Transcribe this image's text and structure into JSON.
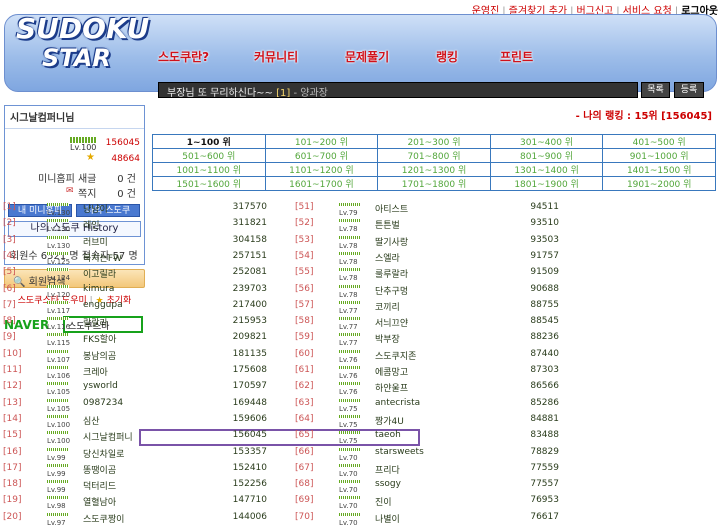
{
  "top_links": [
    "운영진",
    "즐겨찾기 추가",
    "버그신고",
    "서비스 요청",
    "로그아웃"
  ],
  "logo": {
    "line1": "SUDOKU",
    "line2": "STAR"
  },
  "menu": [
    "스도쿠란?",
    "커뮤니티",
    "문제풀기",
    "랭킹",
    "프린트"
  ],
  "notice": {
    "text": "부장님 또 무리하신다~~",
    "num": "[1]",
    "author": "- 양과장"
  },
  "notice_buttons": [
    "목록",
    "등록"
  ],
  "user": {
    "name": "시그날컴퍼니님",
    "level": "Lv.100",
    "score": "156045",
    "star_value": "48664",
    "unread_label": "미니홈피 새글",
    "unread": "0 건",
    "note_label": "쪽지",
    "note": "0 건",
    "btn_home": "내 미니홈피",
    "btn_sudoku": "나의 스도쿠",
    "btn_history": "나의 스도쿠 History"
  },
  "counts": "회원수 6521 명  접속자 57 명",
  "search_label": "회원검색",
  "help": {
    "left": "스도쿠스타 도우미",
    "right": "초기화"
  },
  "naver": {
    "label": "NAVER",
    "select": "스도쿠스타"
  },
  "my_rank": "- 나의 랭킹 : 15위 [156045]",
  "rank_ranges": [
    [
      "1~100 위",
      "101~200 위",
      "201~300 위",
      "301~400 위",
      "401~500 위"
    ],
    [
      "501~600 위",
      "601~700 위",
      "701~800 위",
      "801~900 위",
      "901~1000 위"
    ],
    [
      "1001~1100 위",
      "1101~1200 위",
      "1201~1300 위",
      "1301~1400 위",
      "1401~1500 위"
    ],
    [
      "1501~1600 위",
      "1601~1700 위",
      "1701~1800 위",
      "1801~1900 위",
      "1901~2000 위"
    ]
  ],
  "left_ranks": [
    {
      "rank": "[1]",
      "lv": "Lv.130",
      "name": "냥냥이",
      "score": "317570"
    },
    {
      "rank": "[2]",
      "lv": "Lv.130",
      "name": "레인",
      "score": "311821"
    },
    {
      "rank": "[3]",
      "lv": "Lv.130",
      "name": "러브미",
      "score": "304158"
    },
    {
      "rank": "[4]",
      "lv": "Lv.125",
      "name": "북치는FW",
      "score": "257151"
    },
    {
      "rank": "[5]",
      "lv": "Lv.124",
      "name": "이고릴라",
      "score": "252081"
    },
    {
      "rank": "[6]",
      "lv": "Lv.120",
      "name": "kimura",
      "score": "239703"
    },
    {
      "rank": "[7]",
      "lv": "Lv.117",
      "name": "enggupa",
      "score": "217400"
    },
    {
      "rank": "[8]",
      "lv": "Lv.116",
      "name": "랄랄라",
      "score": "215953"
    },
    {
      "rank": "[9]",
      "lv": "Lv.115",
      "name": "FKS할아",
      "score": "209821"
    },
    {
      "rank": "[10]",
      "lv": "Lv.107",
      "name": "봉남의곰",
      "score": "181135"
    },
    {
      "rank": "[11]",
      "lv": "Lv.106",
      "name": "크레아",
      "score": "175608"
    },
    {
      "rank": "[12]",
      "lv": "Lv.105",
      "name": "ysworld",
      "score": "170597"
    },
    {
      "rank": "[13]",
      "lv": "Lv.105",
      "name": "0987234",
      "score": "169448"
    },
    {
      "rank": "[14]",
      "lv": "Lv.100",
      "name": "심산",
      "score": "159606"
    },
    {
      "rank": "[15]",
      "lv": "Lv.100",
      "name": "시그날컴퍼니",
      "score": "156045"
    },
    {
      "rank": "[16]",
      "lv": "Lv.99",
      "name": "당신차일로",
      "score": "153357"
    },
    {
      "rank": "[17]",
      "lv": "Lv.99",
      "name": "똥땡이곰",
      "score": "152410"
    },
    {
      "rank": "[18]",
      "lv": "Lv.99",
      "name": "덕터리드",
      "score": "152256"
    },
    {
      "rank": "[19]",
      "lv": "Lv.98",
      "name": "열혈남아",
      "score": "147710"
    },
    {
      "rank": "[20]",
      "lv": "Lv.97",
      "name": "스도쿠짱이",
      "score": "144006"
    }
  ],
  "right_ranks": [
    {
      "rank": "[51]",
      "lv": "Lv.79",
      "name": "아티스트",
      "score": "94511"
    },
    {
      "rank": "[52]",
      "lv": "Lv.78",
      "name": "튼튼벌",
      "score": "93510"
    },
    {
      "rank": "[53]",
      "lv": "Lv.78",
      "name": "딸기사랑",
      "score": "93503"
    },
    {
      "rank": "[54]",
      "lv": "Lv.78",
      "name": "스엘라",
      "score": "91757"
    },
    {
      "rank": "[55]",
      "lv": "Lv.78",
      "name": "룰루랄라",
      "score": "91509"
    },
    {
      "rank": "[56]",
      "lv": "Lv.78",
      "name": "단추구멍",
      "score": "90688"
    },
    {
      "rank": "[57]",
      "lv": "Lv.77",
      "name": "코끼리",
      "score": "88755"
    },
    {
      "rank": "[58]",
      "lv": "Lv.77",
      "name": "서늬끄얀",
      "score": "88545"
    },
    {
      "rank": "[59]",
      "lv": "Lv.77",
      "name": "박부장",
      "score": "88236"
    },
    {
      "rank": "[60]",
      "lv": "Lv.76",
      "name": "스도쿠지존",
      "score": "87440"
    },
    {
      "rank": "[61]",
      "lv": "Lv.76",
      "name": "에콤망고",
      "score": "87303"
    },
    {
      "rank": "[62]",
      "lv": "Lv.76",
      "name": "하얀울프",
      "score": "86566"
    },
    {
      "rank": "[63]",
      "lv": "Lv.75",
      "name": "antecrista",
      "score": "85286"
    },
    {
      "rank": "[64]",
      "lv": "Lv.75",
      "name": "짱가4U",
      "score": "84881"
    },
    {
      "rank": "[65]",
      "lv": "Lv.75",
      "name": "taeoh",
      "score": "83488"
    },
    {
      "rank": "[66]",
      "lv": "Lv.70",
      "name": "starsweets",
      "score": "78829"
    },
    {
      "rank": "[67]",
      "lv": "Lv.70",
      "name": "프리다",
      "score": "77559"
    },
    {
      "rank": "[68]",
      "lv": "Lv.70",
      "name": "ssogy",
      "score": "77557"
    },
    {
      "rank": "[69]",
      "lv": "Lv.70",
      "name": "진이",
      "score": "76953"
    },
    {
      "rank": "[70]",
      "lv": "Lv.70",
      "name": "나별이",
      "score": "76617"
    }
  ]
}
